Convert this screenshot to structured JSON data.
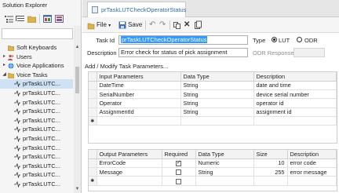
{
  "solution_explorer": {
    "title": "Solution Explorer",
    "search_placeholder": "",
    "tree": [
      {
        "label": "Soft Keyboards",
        "icon": "folder-icon",
        "expander": ""
      },
      {
        "label": "Users",
        "icon": "users-icon",
        "expander": "▸"
      },
      {
        "label": "Voice Applications",
        "icon": "globe-icon",
        "expander": "▸"
      },
      {
        "label": "Voice Tasks",
        "icon": "voice-task-folder-icon",
        "expander": "◢"
      },
      {
        "label": "prTaskLUTC...",
        "icon": "task-icon",
        "expander": ""
      },
      {
        "label": "prTaskLUTC...",
        "icon": "task-icon",
        "expander": ""
      },
      {
        "label": "prTaskLUTC...",
        "icon": "task-icon",
        "expander": ""
      },
      {
        "label": "prTaskLUTC...",
        "icon": "task-icon",
        "expander": ""
      },
      {
        "label": "prTaskLUTC...",
        "icon": "task-icon",
        "expander": ""
      },
      {
        "label": "prTaskLUTC...",
        "icon": "task-icon",
        "expander": ""
      },
      {
        "label": "prTaskLUTC...",
        "icon": "task-icon",
        "expander": ""
      },
      {
        "label": "prTaskLUTC...",
        "icon": "task-icon",
        "expander": ""
      },
      {
        "label": "prTaskLUTC...",
        "icon": "task-icon",
        "expander": ""
      },
      {
        "label": "prTaskLUTC...",
        "icon": "task-icon",
        "expander": ""
      },
      {
        "label": "prTaskLUTC...",
        "icon": "task-icon",
        "expander": ""
      },
      {
        "label": "prTaskLUTC...",
        "icon": "task-icon",
        "expander": ""
      }
    ],
    "selected_index": 4
  },
  "tab": {
    "label": "prTaskLUTCheckOperatorStatus"
  },
  "toolbar": {
    "file_label": "File",
    "save_label": "Save"
  },
  "form": {
    "task_id_label": "Task Id",
    "task_id_value": "prTaskLUTCheckOperatorStatus",
    "type_label": "Type",
    "lut_label": "LUT",
    "odr_label": "ODR",
    "description_label": "Description",
    "description_value": "Error check for status of pick assignment",
    "odr_response_label": "ODR Response",
    "odr_response_value": ""
  },
  "section_header": "Add / Modify Task Parameters...",
  "input_grid": {
    "columns": [
      "Input Parameters",
      "Data Type",
      "Description"
    ],
    "rows": [
      [
        "DateTime",
        "String",
        "date and time"
      ],
      [
        "SerialNumber",
        "String",
        "device serial number"
      ],
      [
        "Operator",
        "String",
        "operator id"
      ],
      [
        "AssignmentId",
        "String",
        "assignment id"
      ]
    ],
    "new_row_marker": "✱"
  },
  "output_grid": {
    "columns": [
      "Output Parameters",
      "Required",
      "Data Type",
      "Size",
      "Description"
    ],
    "rows": [
      {
        "name": "ErrorCode",
        "required": true,
        "type": "Numeric",
        "size": "10",
        "description": "error code"
      },
      {
        "name": "Message",
        "required": false,
        "type": "String",
        "size": "255",
        "description": "error message"
      }
    ],
    "new_row_marker": "✱"
  },
  "colors": {
    "accent": "#2a6ab3",
    "selection": "#3399ff",
    "tree_selection": "#cfe1f5"
  }
}
